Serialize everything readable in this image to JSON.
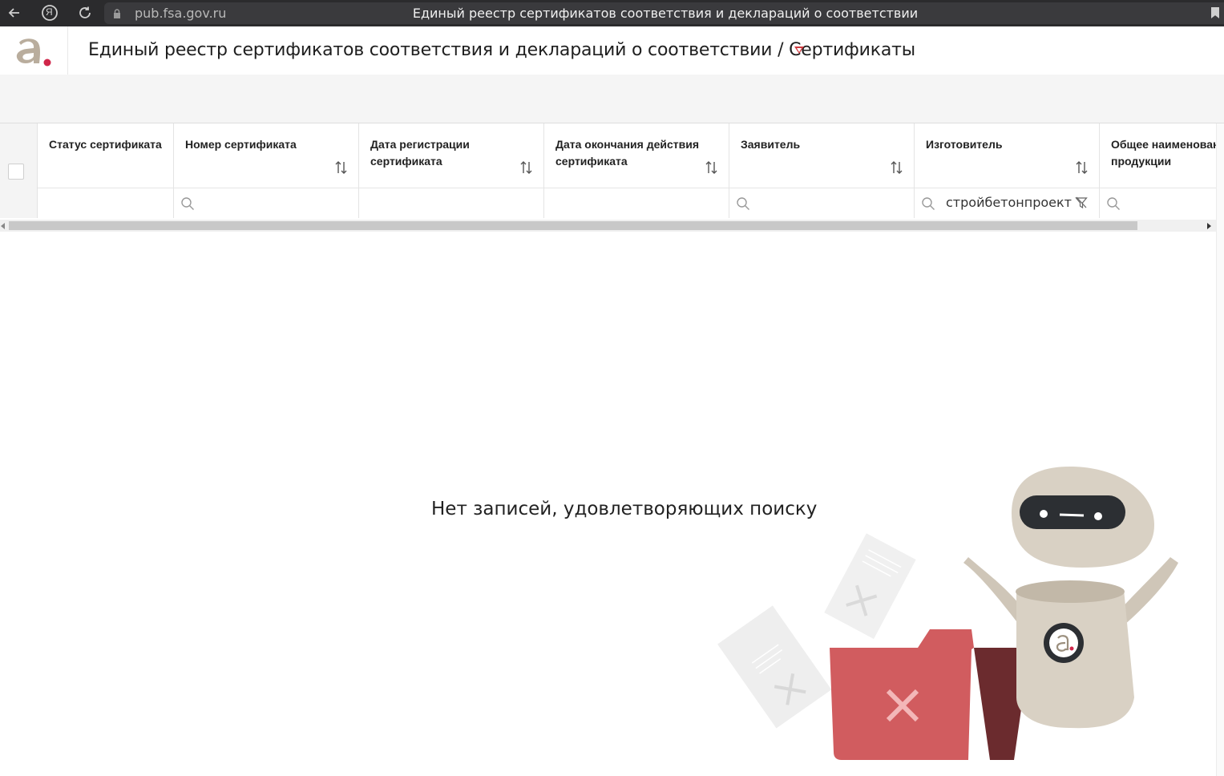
{
  "browser": {
    "url": "pub.fsa.gov.ru",
    "tab_title": "Единый реестр сертификатов соответствия и деклараций о соответствии",
    "yandex_glyph": "Я"
  },
  "app": {
    "title": "Единый реестр сертификатов соответствия и деклараций о соответствии / Сертификаты",
    "brand_color": "#d03a3f"
  },
  "table": {
    "columns": [
      {
        "label": "Статус сертификата",
        "sortable": false,
        "filter_search": false,
        "filter_value": ""
      },
      {
        "label": "Номер сертификата",
        "sortable": true,
        "filter_search": true,
        "filter_value": ""
      },
      {
        "label": "Дата регистрации сертификата",
        "sortable": true,
        "filter_search": false,
        "filter_value": ""
      },
      {
        "label": "Дата окончания действия сертификата",
        "sortable": true,
        "filter_search": false,
        "filter_value": ""
      },
      {
        "label": "Заявитель",
        "sortable": true,
        "filter_search": true,
        "filter_value": ""
      },
      {
        "label": "Изготовитель",
        "sortable": true,
        "filter_search": true,
        "filter_value": "стройбетонпроект"
      },
      {
        "label": "Общее наименовани продукции",
        "sortable": false,
        "filter_search": true,
        "filter_value": ""
      }
    ]
  },
  "empty_state": {
    "message": "Нет записей, удовлетворяющих поиску"
  }
}
